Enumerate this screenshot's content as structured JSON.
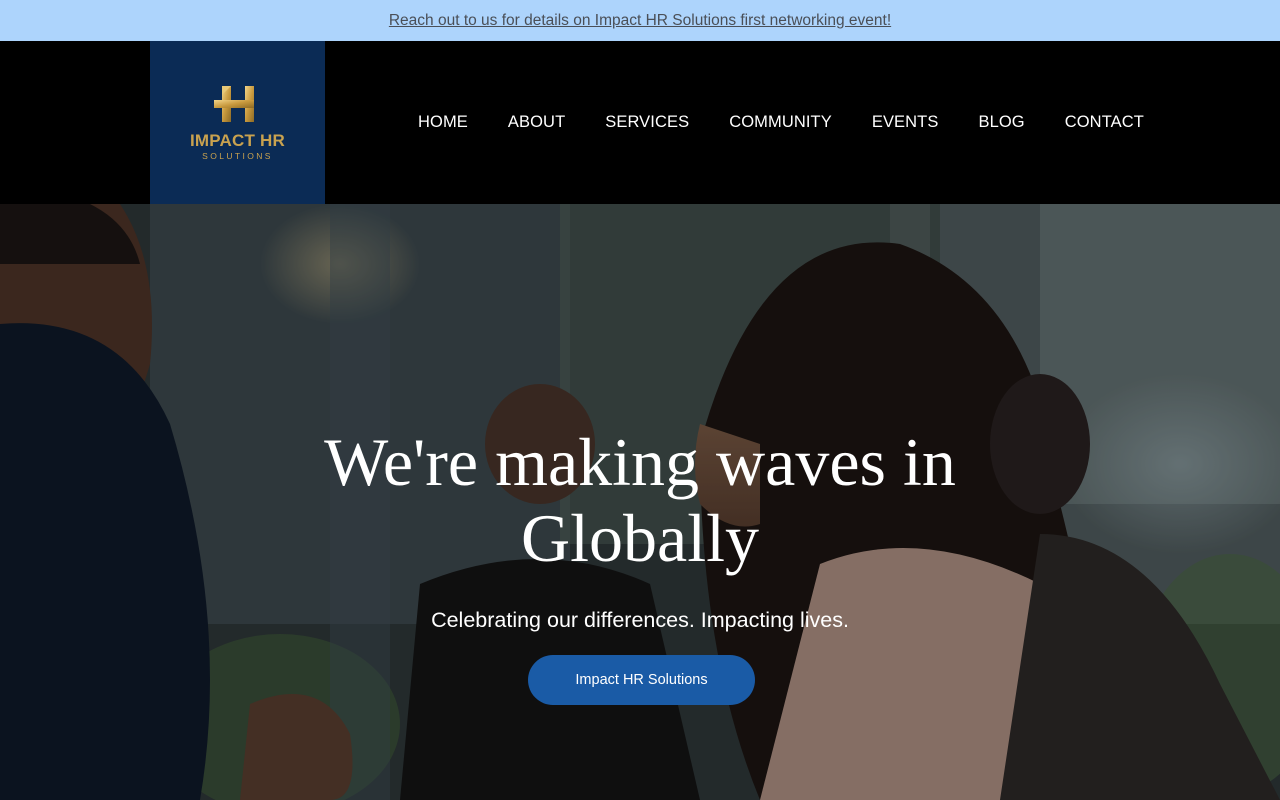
{
  "announcement": {
    "text": "Reach out to us for details on Impact HR Solutions first networking event!"
  },
  "logo": {
    "name": "IMPACT HR",
    "subtitle": "SOLUTIONS"
  },
  "nav": {
    "items": [
      {
        "label": "HOME"
      },
      {
        "label": "ABOUT"
      },
      {
        "label": "SERVICES"
      },
      {
        "label": "COMMUNITY"
      },
      {
        "label": "EVENTS"
      },
      {
        "label": "BLOG"
      },
      {
        "label": "CONTACT"
      }
    ]
  },
  "hero": {
    "title_line1": "We're making waves in",
    "title_line2": "Globally",
    "subtitle": "Celebrating our differences. Impacting lives.",
    "button_label": "Impact HR Solutions"
  },
  "colors": {
    "announcement_bg": "#add4fc",
    "logo_bg": "#0b2b55",
    "logo_gold": "#c9a24f",
    "button_bg": "#1a5ba6"
  }
}
